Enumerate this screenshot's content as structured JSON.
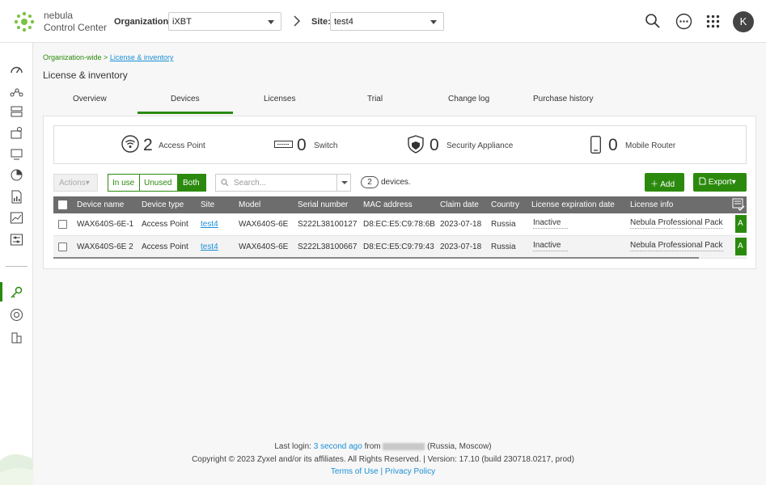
{
  "header": {
    "brand_line1": "nebula",
    "brand_line2": "Control Center",
    "org_label": "Organization:",
    "org_value": "iXBT",
    "site_label": "Site:",
    "site_value": "test4",
    "avatar_initial": "K"
  },
  "breadcrumb": {
    "root": "Organization-wide >",
    "current": "License & inventory"
  },
  "page_title": "License & inventory",
  "tabs": [
    "Overview",
    "Devices",
    "Licenses",
    "Trial",
    "Change log",
    "Purchase history"
  ],
  "active_tab": "Devices",
  "summary": [
    {
      "count": "2",
      "label": "Access Point",
      "icon": "access-point-icon"
    },
    {
      "count": "0",
      "label": "Switch",
      "icon": "switch-icon"
    },
    {
      "count": "0",
      "label": "Security Appliance",
      "icon": "shield-icon"
    },
    {
      "count": "0",
      "label": "Mobile Router",
      "icon": "mobile-router-icon"
    }
  ],
  "toolbar": {
    "actions_label": "Actions",
    "filter_in_use": "In use",
    "filter_unused": "Unused",
    "filter_both": "Both",
    "search_placeholder": "Search...",
    "device_count": "2",
    "device_count_label": "devices.",
    "add_label": "Add",
    "export_label": "Export"
  },
  "table": {
    "columns": [
      "Device name",
      "Device type",
      "Site",
      "Model",
      "Serial number",
      "MAC address",
      "Claim date",
      "Country",
      "License expiration date",
      "License info"
    ],
    "rows": [
      {
        "device_name": "WAX640S-6E-1",
        "device_type": "Access Point",
        "site": "test4",
        "model": "WAX640S-6E",
        "serial": "S222L38100127",
        "mac": "D8:EC:E5:C9:78:6B",
        "claim_date": "2023-07-18",
        "country": "Russia",
        "expiration": "Inactive",
        "license_info": "Nebula Professional Pack",
        "action": "A"
      },
      {
        "device_name": "WAX640S-6E 2",
        "device_type": "Access Point",
        "site": "test4",
        "model": "WAX640S-6E",
        "serial": "S222L38100667",
        "mac": "D8:EC:E5:C9:79:43",
        "claim_date": "2023-07-18",
        "country": "Russia",
        "expiration": "Inactive",
        "license_info": "Nebula Professional Pack",
        "action": "A"
      }
    ]
  },
  "footer": {
    "last_login_label": "Last login:",
    "last_login_value": "3 second ago",
    "from_label": "from",
    "location": "(Russia, Moscow)",
    "copyright": "Copyright © 2023 Zyxel and/or its affiliates. All Rights Reserved. | Version: 17.10 (build 230718.0217, prod)",
    "terms": "Terms of Use",
    "separator": "|",
    "privacy": "Privacy Policy"
  },
  "colors": {
    "accent": "#2b8a0e",
    "link": "#1b8fd6",
    "table_header": "#6d6d6d"
  }
}
